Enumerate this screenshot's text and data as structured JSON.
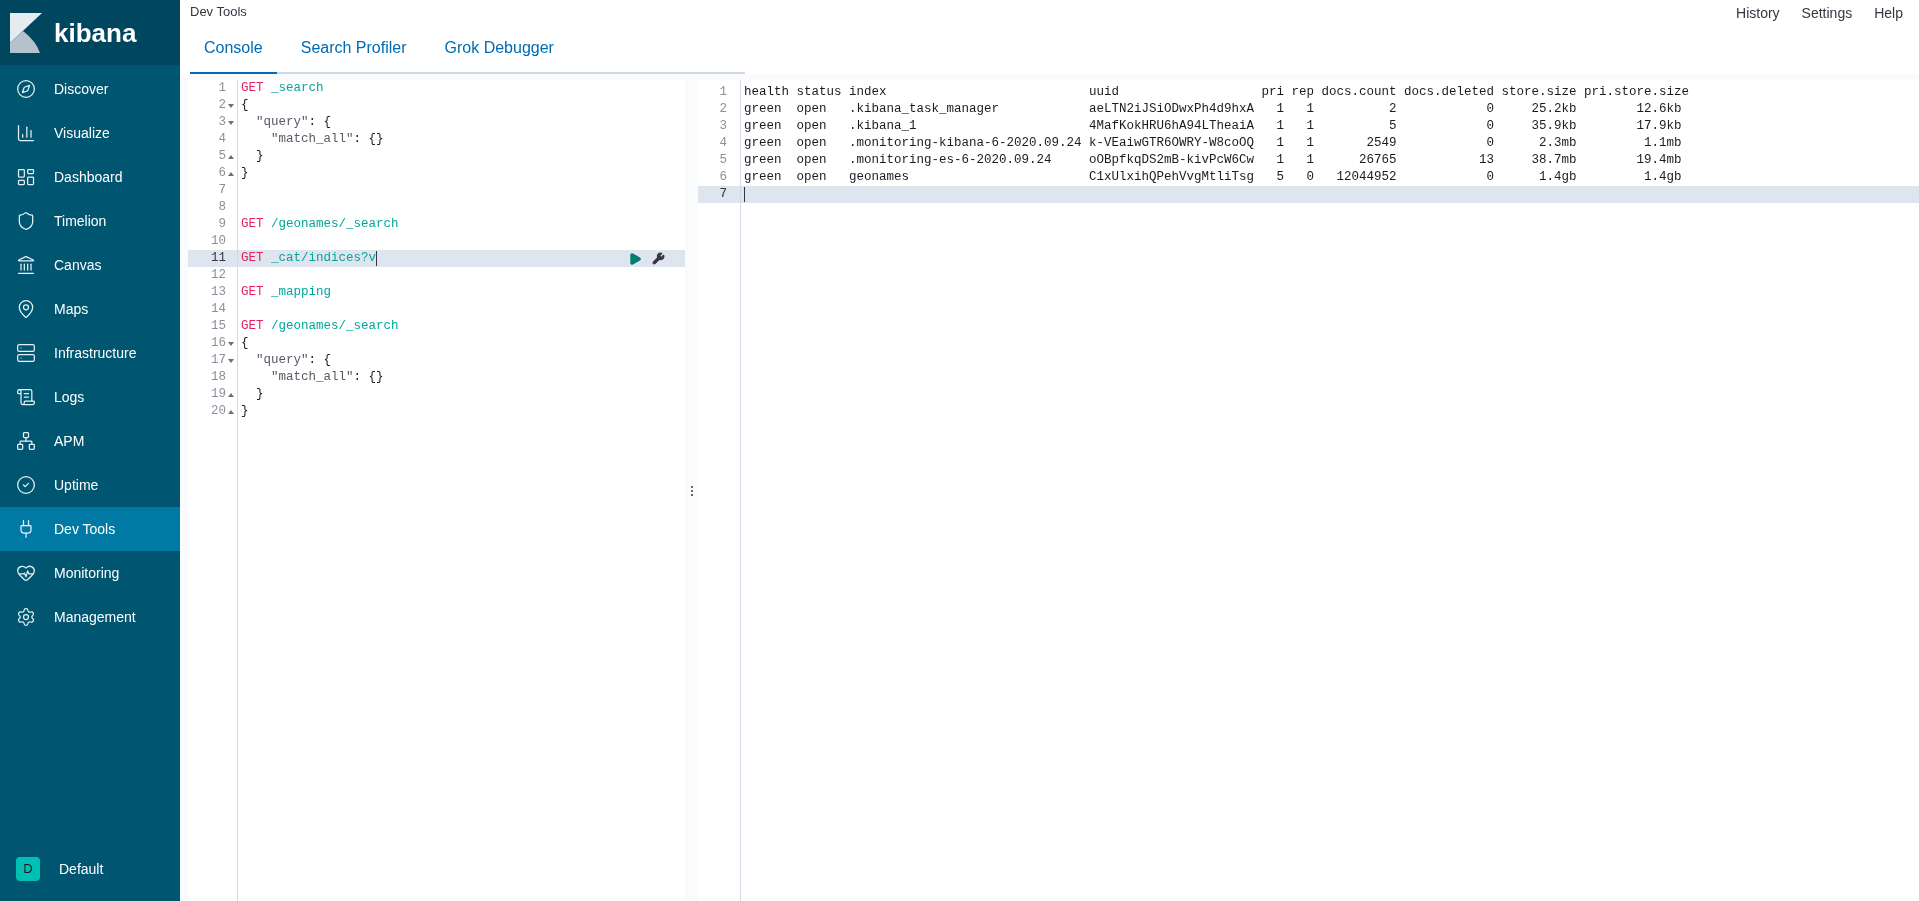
{
  "sidebar": {
    "logo": "kibana",
    "items": [
      {
        "label": "Discover",
        "selected": false
      },
      {
        "label": "Visualize",
        "selected": false
      },
      {
        "label": "Dashboard",
        "selected": false
      },
      {
        "label": "Timelion",
        "selected": false
      },
      {
        "label": "Canvas",
        "selected": false
      },
      {
        "label": "Maps",
        "selected": false
      },
      {
        "label": "Infrastructure",
        "selected": false
      },
      {
        "label": "Logs",
        "selected": false
      },
      {
        "label": "APM",
        "selected": false
      },
      {
        "label": "Uptime",
        "selected": false
      },
      {
        "label": "Dev Tools",
        "selected": true
      },
      {
        "label": "Monitoring",
        "selected": false
      },
      {
        "label": "Management",
        "selected": false
      }
    ],
    "space": {
      "avatar": "D",
      "label": "Default"
    }
  },
  "header": {
    "title": "Dev Tools",
    "links": [
      "History",
      "Settings",
      "Help"
    ]
  },
  "tabs": [
    {
      "label": "Console",
      "selected": true
    },
    {
      "label": "Search Profiler",
      "selected": false
    },
    {
      "label": "Grok Debugger",
      "selected": false
    }
  ],
  "editor": {
    "lines": [
      {
        "number": "1",
        "selected": false,
        "tokens": [
          {
            "kind": "method",
            "text": "GET"
          },
          {
            "kind": "path",
            "text": " _search"
          }
        ]
      },
      {
        "number": "2",
        "selected": false,
        "kind": "start",
        "tokens": [
          {
            "kind": "punct",
            "text": "{"
          }
        ]
      },
      {
        "number": "3",
        "selected": false,
        "kind": "start",
        "tokens": [
          {
            "kind": "key",
            "text": "  \"query\""
          },
          {
            "kind": "punct",
            "text": ": {"
          }
        ]
      },
      {
        "number": "4",
        "selected": false,
        "tokens": [
          {
            "kind": "key",
            "text": "    \"match_all\""
          },
          {
            "kind": "punct",
            "text": ": {}"
          }
        ]
      },
      {
        "number": "5",
        "selected": false,
        "kind": "end",
        "tokens": [
          {
            "kind": "punct",
            "text": "  }"
          }
        ]
      },
      {
        "number": "6",
        "selected": false,
        "kind": "end",
        "tokens": [
          {
            "kind": "punct",
            "text": "}"
          }
        ]
      },
      {
        "number": "7",
        "selected": false
      },
      {
        "number": "8",
        "selected": false
      },
      {
        "number": "9",
        "selected": false,
        "tokens": [
          {
            "kind": "method",
            "text": "GET"
          },
          {
            "kind": "path",
            "text": " /geonames/_search"
          }
        ]
      },
      {
        "number": "10",
        "selected": false
      },
      {
        "number": "11",
        "selected": true,
        "tokens": [
          {
            "kind": "method",
            "text": "GET"
          },
          {
            "kind": "path",
            "text": " _cat/indices?v"
          }
        ]
      },
      {
        "number": "12",
        "selected": false
      },
      {
        "number": "13",
        "selected": false,
        "tokens": [
          {
            "kind": "method",
            "text": "GET"
          },
          {
            "kind": "path",
            "text": " _mapping"
          }
        ]
      },
      {
        "number": "14",
        "selected": false
      },
      {
        "number": "15",
        "selected": false,
        "tokens": [
          {
            "kind": "method",
            "text": "GET"
          },
          {
            "kind": "path",
            "text": " /geonames/_search"
          }
        ]
      },
      {
        "number": "16",
        "selected": false,
        "kind": "start",
        "tokens": [
          {
            "kind": "punct",
            "text": "{"
          }
        ]
      },
      {
        "number": "17",
        "selected": false,
        "kind": "start",
        "tokens": [
          {
            "kind": "key",
            "text": "  \"query\""
          },
          {
            "kind": "punct",
            "text": ": {"
          }
        ]
      },
      {
        "number": "18",
        "selected": false,
        "tokens": [
          {
            "kind": "key",
            "text": "    \"match_all\""
          },
          {
            "kind": "punct",
            "text": ": {}"
          }
        ]
      },
      {
        "number": "19",
        "selected": false,
        "kind": "end",
        "tokens": [
          {
            "kind": "punct",
            "text": "  }"
          }
        ]
      },
      {
        "number": "20",
        "selected": false,
        "kind": "end",
        "tokens": [
          {
            "kind": "punct",
            "text": "}"
          }
        ]
      }
    ]
  },
  "output": {
    "lines": [
      {
        "number": "1",
        "selected": false,
        "cells": [
          "health",
          "status",
          "index",
          "uuid",
          "pri",
          "rep",
          "docs.count",
          "docs.deleted",
          "store.size",
          "pri.store.size"
        ]
      },
      {
        "number": "2",
        "selected": false,
        "cells": [
          "green",
          "open",
          ".kibana_task_manager",
          "aeLTN2iJSiODwxPh4d9hxA",
          "1",
          "1",
          "2",
          "0",
          "25.2kb",
          "12.6kb"
        ]
      },
      {
        "number": "3",
        "selected": false,
        "cells": [
          "green",
          "open",
          ".kibana_1",
          "4MafKokHRU6hA94LTheaiA",
          "1",
          "1",
          "5",
          "0",
          "35.9kb",
          "17.9kb"
        ]
      },
      {
        "number": "4",
        "selected": false,
        "cells": [
          "green",
          "open",
          ".monitoring-kibana-6-2020.09.24",
          "k-VEaiwGTR6OWRY-W8coOQ",
          "1",
          "1",
          "2549",
          "0",
          "2.3mb",
          "1.1mb"
        ]
      },
      {
        "number": "5",
        "selected": false,
        "cells": [
          "green",
          "open",
          ".monitoring-es-6-2020.09.24",
          "oOBpfkqDS2mB-kivPcW6Cw",
          "1",
          "1",
          "26765",
          "13",
          "38.7mb",
          "19.4mb"
        ]
      },
      {
        "number": "6",
        "selected": false,
        "cells": [
          "green",
          "open",
          "geonames",
          "C1xUlxihQPehVvgMtliTsg",
          "5",
          "0",
          "12044952",
          "0",
          "1.4gb",
          "1.4gb"
        ]
      },
      {
        "number": "7",
        "selected": true
      }
    ]
  }
}
